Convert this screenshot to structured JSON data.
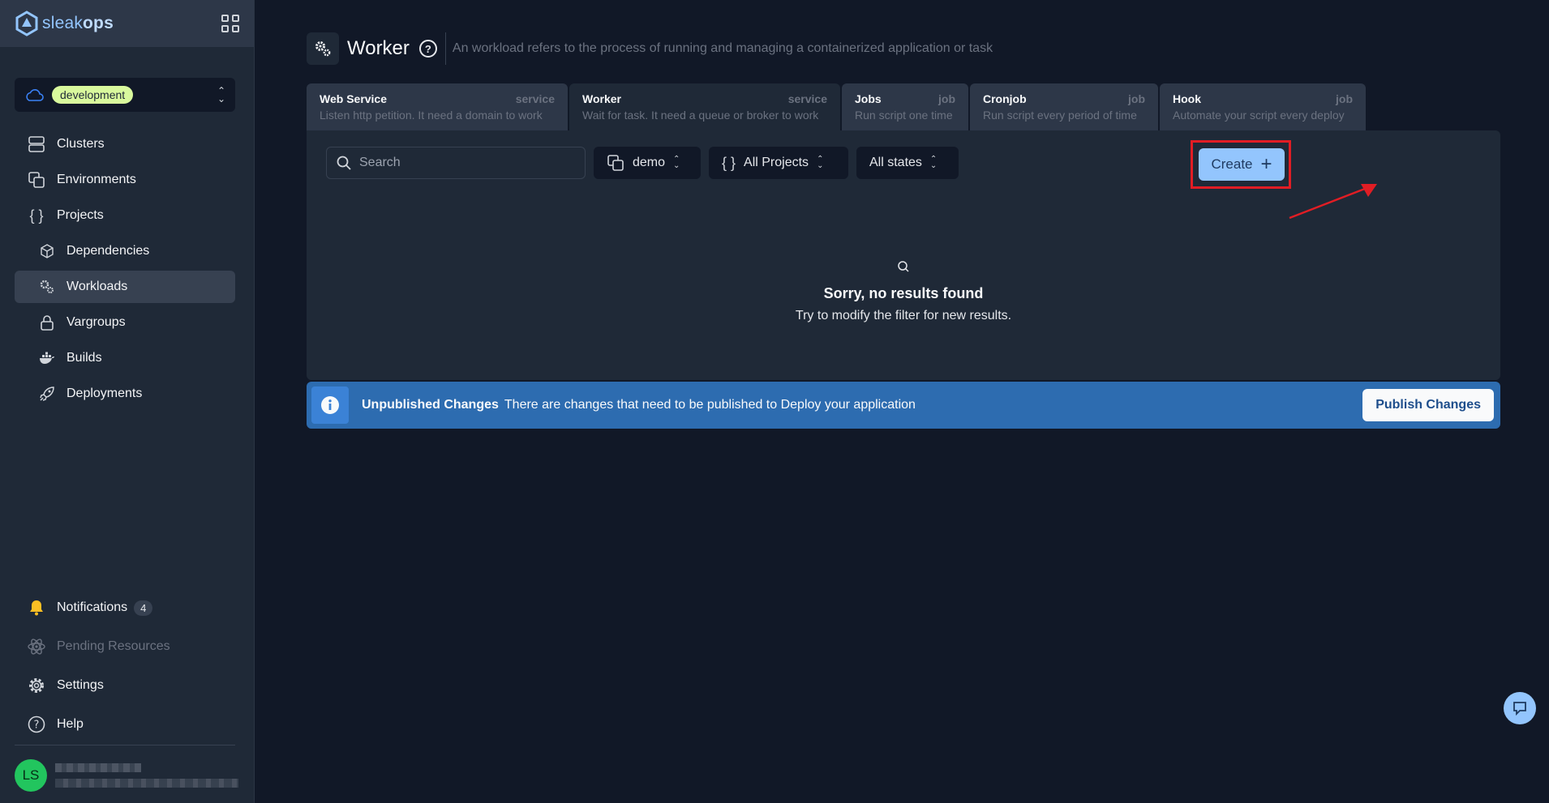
{
  "brand": {
    "prefix": "sleak",
    "suffix": "ops"
  },
  "environment": {
    "label": "development"
  },
  "sidebar": {
    "items": [
      {
        "label": "Clusters"
      },
      {
        "label": "Environments"
      },
      {
        "label": "Projects"
      },
      {
        "label": "Dependencies"
      },
      {
        "label": "Workloads"
      },
      {
        "label": "Vargroups"
      },
      {
        "label": "Builds"
      },
      {
        "label": "Deployments"
      }
    ],
    "bottom": [
      {
        "label": "Notifications",
        "count": "4"
      },
      {
        "label": "Pending Resources"
      },
      {
        "label": "Settings"
      },
      {
        "label": "Help"
      }
    ]
  },
  "user": {
    "initials": "LS"
  },
  "header": {
    "title": "Worker",
    "description": "An workload refers to the process of running and managing a containerized application or task"
  },
  "tabs": [
    {
      "name": "Web Service",
      "kind": "service",
      "desc": "Listen http petition. It need a domain to work"
    },
    {
      "name": "Worker",
      "kind": "service",
      "desc": "Wait for task. It need a queue or broker to work"
    },
    {
      "name": "Jobs",
      "kind": "job",
      "desc": "Run script one time"
    },
    {
      "name": "Cronjob",
      "kind": "job",
      "desc": "Run script every period of time"
    },
    {
      "name": "Hook",
      "kind": "job",
      "desc": "Automate your script every deploy"
    }
  ],
  "toolbar": {
    "search_placeholder": "Search",
    "env_filter": "demo",
    "project_filter": "All Projects",
    "state_filter": "All states",
    "create_label": "Create"
  },
  "empty": {
    "title": "Sorry, no results found",
    "subtitle": "Try to modify the filter for new results."
  },
  "banner": {
    "title": "Unpublished Changes",
    "text": "There are changes that need to be published to Deploy your application",
    "button": "Publish Changes"
  },
  "colors": {
    "accent": "#93c5fd",
    "banner": "#2d6cb0",
    "highlight": "#e11d24"
  }
}
